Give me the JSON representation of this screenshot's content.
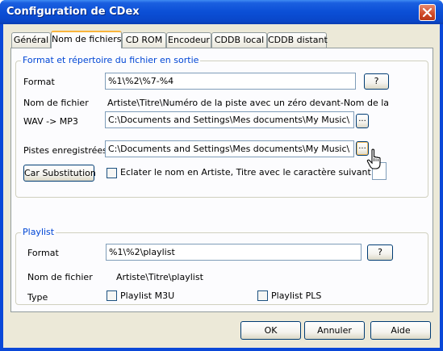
{
  "window": {
    "title": "Configuration de CDex"
  },
  "tabs": [
    {
      "label": "Général",
      "active": false
    },
    {
      "label": "Nom de fichiers",
      "active": true
    },
    {
      "label": "CD ROM",
      "active": false
    },
    {
      "label": "Encodeur",
      "active": false
    },
    {
      "label": "CDDB local",
      "active": false
    },
    {
      "label": "CDDB distant",
      "active": false
    }
  ],
  "output_group": {
    "legend": "Format et répertoire du fichier en sortie",
    "format_label": "Format",
    "format_value": "%1\\%2\\%7-%4",
    "help_label": "?",
    "filename_label": "Nom de fichier",
    "filename_preview": "Artiste\\Titre\\Numéro de la piste avec un zéro devant-Nom de la",
    "wav_mp3_label": "WAV -> MP3",
    "wav_mp3_path": "C:\\Documents and Settings\\Mes documents\\My Music\\",
    "browse_label": "...",
    "tracks_label": "Pistes enregistrées",
    "tracks_path": "C:\\Documents and Settings\\Mes documents\\My Music\\",
    "car_substitution_label": "Car Substitution",
    "split_checkbox_label": "Eclater le nom en Artiste, Titre avec le caractère suivant:",
    "split_checked": false,
    "split_char_value": ""
  },
  "playlist_group": {
    "legend": "Playlist",
    "format_label": "Format",
    "format_value": "%1\\%2\\playlist",
    "help_label": "?",
    "filename_label": "Nom de fichier",
    "filename_preview": "Artiste\\Titre\\playlist",
    "type_label": "Type",
    "m3u_label": "Playlist M3U",
    "m3u_checked": false,
    "pls_label": "Playlist PLS",
    "pls_checked": false
  },
  "footer": {
    "ok_label": "OK",
    "cancel_label": "Annuler",
    "help_label": "Aide"
  },
  "colors": {
    "titlebar": "#0a4fd6",
    "dialog_bg": "#ece9d8",
    "group_legend": "#0046d5",
    "tab_highlight": "#f9b43c"
  }
}
